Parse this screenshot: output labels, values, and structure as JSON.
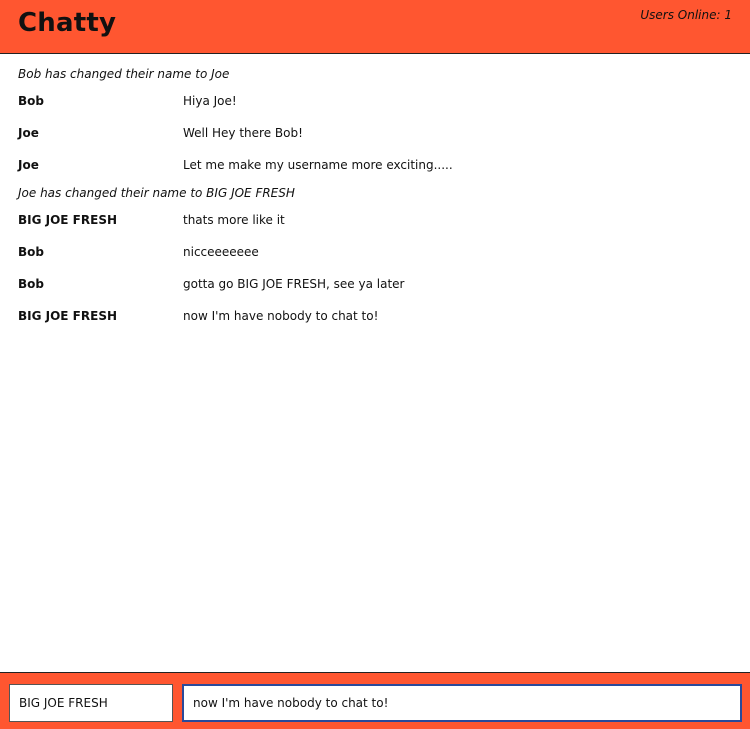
{
  "app": {
    "brand": "Chatty",
    "users_online": "Users Online: 1",
    "colors": {
      "accent": "#ff5630",
      "focus_border": "#2a4a9a"
    }
  },
  "feed": {
    "n0": "Bob has changed their name to Joe",
    "m0": {
      "username": "Bob",
      "content": "Hiya Joe!"
    },
    "m1": {
      "username": "Joe",
      "content": "Well Hey there Bob!"
    },
    "m2": {
      "username": "Joe",
      "content": "Let me make my username more exciting....."
    },
    "n1": "Joe has changed their name to BIG JOE FRESH",
    "m3": {
      "username": "BIG JOE FRESH",
      "content": "thats more like it"
    },
    "m4": {
      "username": "Bob",
      "content": "nicceeeeeee"
    },
    "m5": {
      "username": "Bob",
      "content": "gotta go BIG JOE FRESH, see ya later"
    },
    "m6": {
      "username": "BIG JOE FRESH",
      "content": "now I'm have nobody to chat to!"
    }
  },
  "chatbar": {
    "username_value": "BIG JOE FRESH",
    "message_value": "now I'm have nobody to chat to!"
  }
}
